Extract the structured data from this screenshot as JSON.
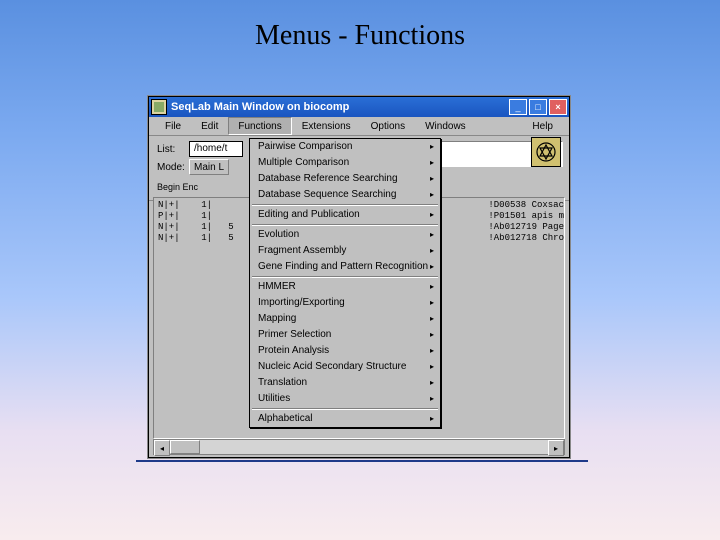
{
  "slide_title": "Menus - Functions",
  "window_title": "SeqLab Main Window on biocomp",
  "menubar": {
    "file": "File",
    "edit": "Edit",
    "functions": "Functions",
    "extensions": "Extensions",
    "options": "Options",
    "windows": "Windows",
    "help": "Help"
  },
  "toolbar": {
    "list_label": "List:",
    "list_value": "/home/t",
    "mode_label": "Mode:",
    "mode_value": "Main L",
    "columns_row": "  Begin    Enc"
  },
  "entries_left": [
    "N|+|    1|",
    "P|+|    1|",
    "N|+|    1|   5",
    "N|+|    1|   5"
  ],
  "entries_right": [
    "!D00538 Coxsac",
    "!P01501 apis m",
    "!Ab012719 Page",
    "!Ab012718 Chro"
  ],
  "functions_menu": [
    {
      "label": "Pairwise Comparison",
      "submenu": true
    },
    {
      "label": "Multiple Comparison",
      "submenu": true
    },
    {
      "label": "Database Reference Searching",
      "submenu": true
    },
    {
      "label": "Database Sequence Searching",
      "submenu": true
    },
    {
      "sep": true
    },
    {
      "label": "Editing and Publication",
      "submenu": true
    },
    {
      "sep": true
    },
    {
      "label": "Evolution",
      "submenu": true
    },
    {
      "label": "Fragment Assembly",
      "submenu": true
    },
    {
      "label": "Gene Finding and Pattern Recognition",
      "submenu": true
    },
    {
      "sep": true
    },
    {
      "label": "HMMER",
      "submenu": true
    },
    {
      "label": "Importing/Exporting",
      "submenu": true
    },
    {
      "label": "Mapping",
      "submenu": true
    },
    {
      "label": "Primer Selection",
      "submenu": true
    },
    {
      "label": "Protein Analysis",
      "submenu": true
    },
    {
      "label": "Nucleic Acid Secondary Structure",
      "submenu": true
    },
    {
      "label": "Translation",
      "submenu": true
    },
    {
      "label": "Utilities",
      "submenu": true
    },
    {
      "sep": true
    },
    {
      "label": "Alphabetical",
      "submenu": true
    }
  ]
}
